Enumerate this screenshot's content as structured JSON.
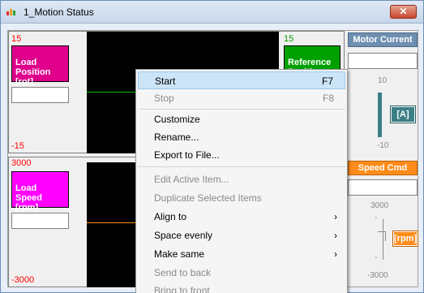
{
  "window": {
    "title": "1_Motion Status",
    "close_glyph": "✕"
  },
  "scope_top": {
    "max_left": "15",
    "min_left": "-15",
    "max_right": "15",
    "left_label": "Load\nPosition\n[rot]",
    "right_label": "Reference\nPosition",
    "left_color": "#e0008c",
    "right_color": "#00a000"
  },
  "scope_bottom": {
    "max_left": "3000",
    "min_left": "-3000",
    "left_label": "Load\nSpeed\n[rpm]",
    "left_color": "#ff00ff"
  },
  "meter_current": {
    "title": "Motor Current",
    "scale_max": "10",
    "scale_min": "-10",
    "unit": "[A]"
  },
  "meter_speed": {
    "title": "Speed Cmd",
    "scale_max": "3000",
    "scale_min": "-3000",
    "tick_top": "-",
    "tick_bottom": "-",
    "unit": "[rpm]"
  },
  "context_menu": {
    "items": [
      {
        "label": "Start",
        "shortcut": "F7"
      },
      {
        "label": "Stop",
        "shortcut": "F8"
      },
      {
        "label": "Customize"
      },
      {
        "label": "Rename..."
      },
      {
        "label": "Export to File..."
      },
      {
        "label": "Edit Active Item..."
      },
      {
        "label": "Duplicate Selected Items"
      },
      {
        "label": "Align to",
        "submenu": "›"
      },
      {
        "label": "Space evenly",
        "submenu": "›"
      },
      {
        "label": "Make same",
        "submenu": "›"
      },
      {
        "label": "Send to back"
      },
      {
        "label": "Bring to front"
      }
    ]
  },
  "colors": {
    "teal": "#3c7f86",
    "orange": "#ff8c1a",
    "trace_green": "#00c000",
    "trace_orange": "#ff8c1a"
  }
}
